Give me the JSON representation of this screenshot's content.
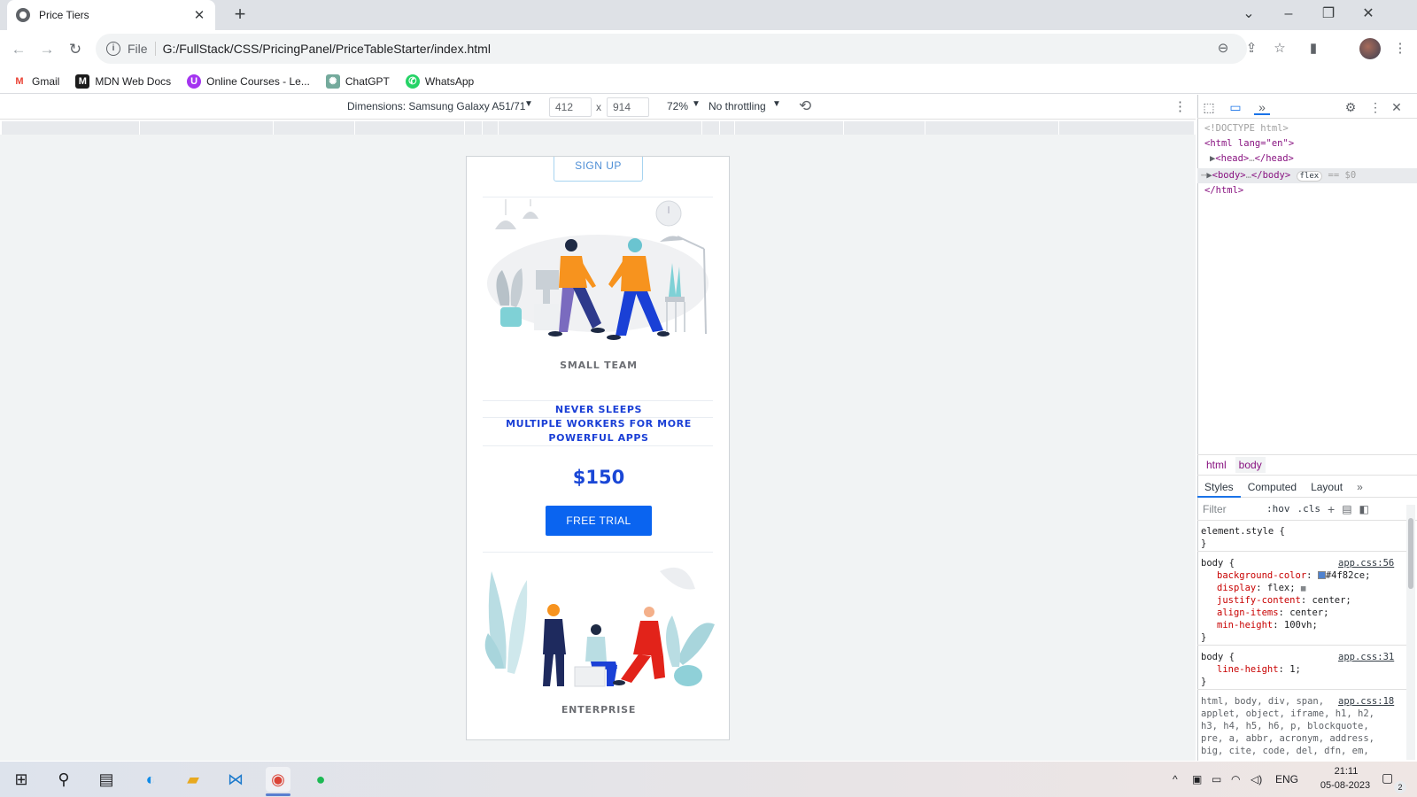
{
  "browser": {
    "tab_title": "Price Tiers",
    "url_scheme": "File",
    "url": "G:/FullStack/CSS/PricingPanel/PriceTableStarter/index.html",
    "bookmarks": [
      {
        "label": "Gmail",
        "icon": "gmail-icon",
        "color": "#ea4335"
      },
      {
        "label": "MDN Web Docs",
        "icon": "mdn-icon",
        "color": "#1b1b1b"
      },
      {
        "label": "Online Courses - Le...",
        "icon": "udemy-icon",
        "color": "#a435f0"
      },
      {
        "label": "ChatGPT",
        "icon": "chatgpt-icon",
        "color": "#74aa9c"
      },
      {
        "label": "WhatsApp",
        "icon": "whatsapp-icon",
        "color": "#25d366"
      }
    ]
  },
  "device_toolbar": {
    "dimensions_label": "Dimensions: Samsung Galaxy A51/71",
    "width": "412",
    "times": "x",
    "height": "914",
    "zoom": "72%",
    "throttling": "No throttling"
  },
  "page": {
    "signup_label": "SIGN UP",
    "tier1_name": "SMALL TEAM",
    "features": [
      "NEVER SLEEPS",
      "MULTIPLE WORKERS FOR MORE",
      "POWERFUL APPS"
    ],
    "price": "$150",
    "cta_label": "FREE TRIAL",
    "tier2_name": "ENTERPRISE"
  },
  "devtools": {
    "dom": {
      "doctype": "<!DOCTYPE html>",
      "html_open": "<html lang=\"en\">",
      "head": "<head>",
      "head_close": "</head>",
      "body": "<body>",
      "body_close": "</body>",
      "flex_badge": "flex",
      "eq": "== $0",
      "html_close": "</html>"
    },
    "crumbs": [
      "html",
      "body"
    ],
    "tabs": [
      "Styles",
      "Computed",
      "Layout"
    ],
    "filter_placeholder": "Filter",
    "hov": ":hov",
    "cls": ".cls",
    "element_style": "element.style {",
    "brace_close": "}",
    "rule1": {
      "selector": "body {",
      "source": "app.css:56",
      "decls": [
        {
          "prop": "background-color",
          "value": "#4f82ce;"
        },
        {
          "prop": "display",
          "value": "flex;"
        },
        {
          "prop": "justify-content",
          "value": "center;"
        },
        {
          "prop": "align-items",
          "value": "center;"
        },
        {
          "prop": "min-height",
          "value": "100vh;"
        }
      ]
    },
    "rule2": {
      "selector": "body {",
      "source": "app.css:31",
      "decls": [
        {
          "prop": "line-height",
          "value": "1;"
        }
      ]
    },
    "rule3": {
      "source": "app.css:18",
      "lines": [
        "html, body, div, span,",
        "applet, object, iframe, h1, h2,",
        "h3, h4, h5, h6, p, blockquote,",
        "pre, a, abbr, acronym, address,",
        "big, cite, code, del, dfn, em,"
      ]
    }
  },
  "taskbar": {
    "language": "ENG",
    "time": "21:11",
    "date": "05-08-2023",
    "notification_count": "2"
  },
  "colors": {
    "accent_blue": "#0a64f0",
    "feature_blue": "#1a3fd6",
    "swatch": "#4f82ce"
  }
}
